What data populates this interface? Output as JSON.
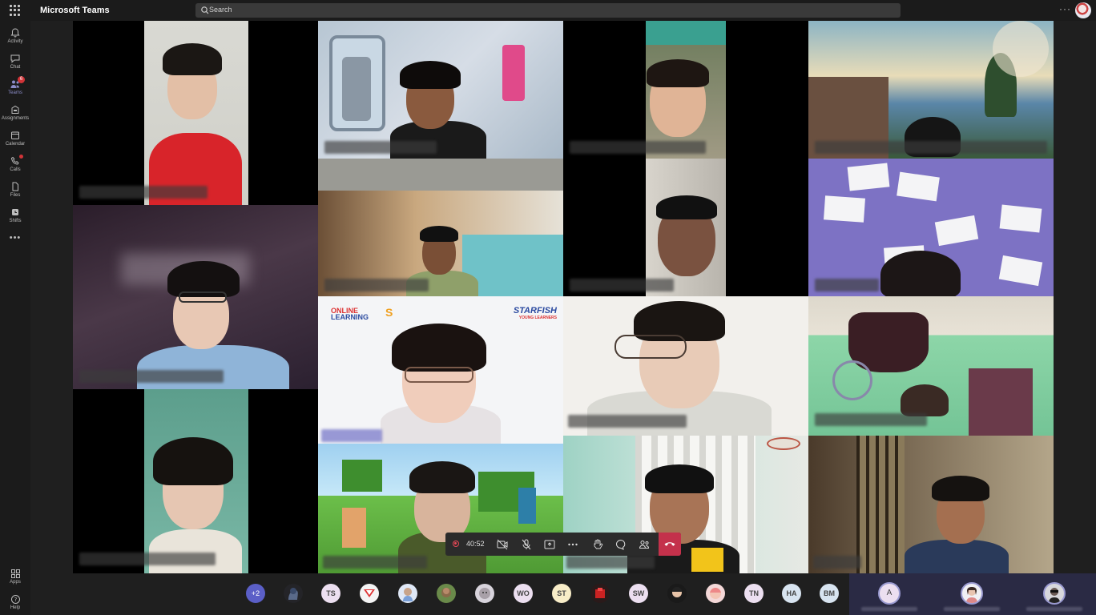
{
  "app": {
    "title": "Microsoft Teams"
  },
  "search": {
    "placeholder": "Search"
  },
  "rail": {
    "items": [
      {
        "label": "Activity",
        "icon": "bell-icon"
      },
      {
        "label": "Chat",
        "icon": "chat-icon"
      },
      {
        "label": "Teams",
        "icon": "teams-icon",
        "badge": "6",
        "active": true
      },
      {
        "label": "Assignments",
        "icon": "assignments-icon"
      },
      {
        "label": "Calendar",
        "icon": "calendar-icon"
      },
      {
        "label": "Calls",
        "icon": "phone-icon"
      },
      {
        "label": "Files",
        "icon": "file-icon"
      },
      {
        "label": "Shifts",
        "icon": "shifts-icon"
      }
    ],
    "more": "•••",
    "apps_label": "Apps",
    "help_label": "Help"
  },
  "tiles": {
    "starfish_online": "ONLINE",
    "starfish_learning": "LEARNING",
    "starfish_s": "S",
    "starfish_brand": "STARFISH",
    "starfish_tagline": "YOUNG LEARNERS"
  },
  "call": {
    "timer": "40:52"
  },
  "roster": {
    "overflow": "+2",
    "initials": [
      "TS",
      "WO",
      "ST",
      "SW",
      "TN",
      "HA",
      "BM"
    ],
    "pinned_initial": "A"
  },
  "colors": {
    "accent": "#5b5fc7",
    "hangup": "#c4314b",
    "badge": "#d13438"
  }
}
